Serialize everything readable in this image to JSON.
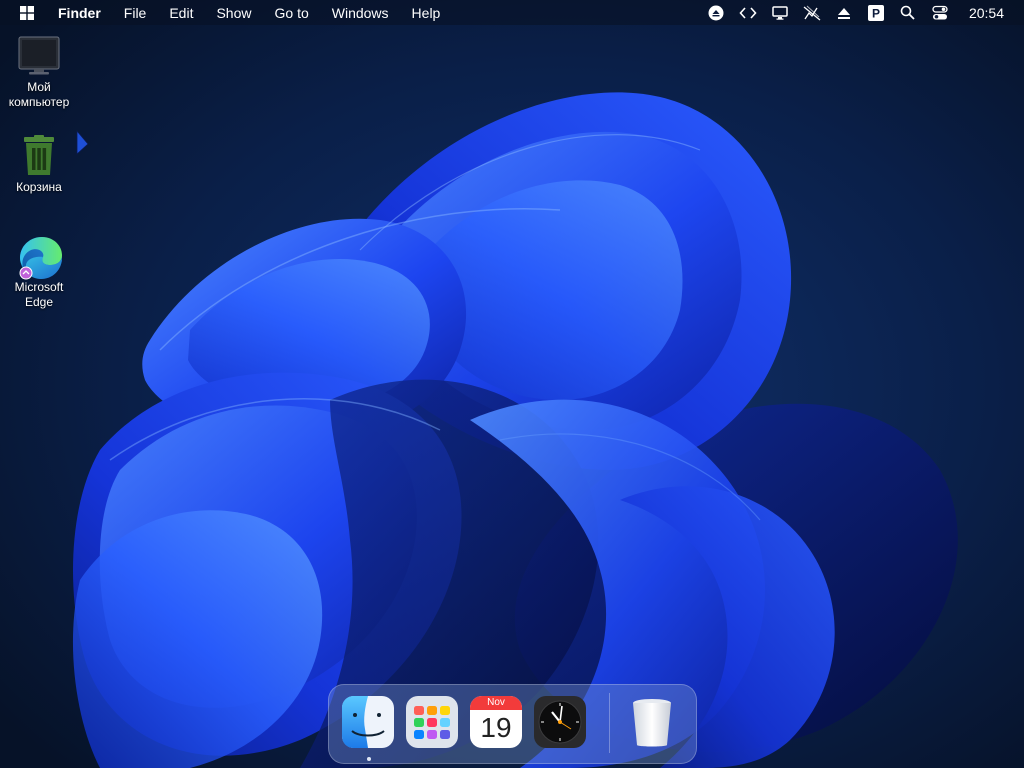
{
  "menubar": {
    "app_name": "Finder",
    "menus": [
      "File",
      "Edit",
      "Show",
      "Go to",
      "Windows",
      "Help"
    ],
    "clock": "20:54",
    "tray_icons": [
      "eject-icon",
      "code-brackets-icon",
      "monitor-icon",
      "no-signal-icon",
      "upload-icon",
      "p-icon",
      "search-icon",
      "control-center-icon"
    ]
  },
  "desktop": {
    "icons": [
      {
        "label_line1": "Мой",
        "label_line2": "компьютер",
        "icon": "monitor-icon"
      },
      {
        "label_line1": "Корзина",
        "label_line2": "",
        "icon": "trash-icon"
      },
      {
        "label_line1": "Microsoft",
        "label_line2": "Edge",
        "icon": "edge-icon"
      }
    ]
  },
  "dock": {
    "items": [
      "finder-icon",
      "launchpad-icon",
      "calendar-icon",
      "clock-icon",
      "trash-icon"
    ],
    "calendar": {
      "month": "Nov",
      "day": "19"
    }
  },
  "colors": {
    "wallpaper_bg": "#071634",
    "bloom_blue": "#1a3df0",
    "bloom_light": "#3b7bff"
  }
}
